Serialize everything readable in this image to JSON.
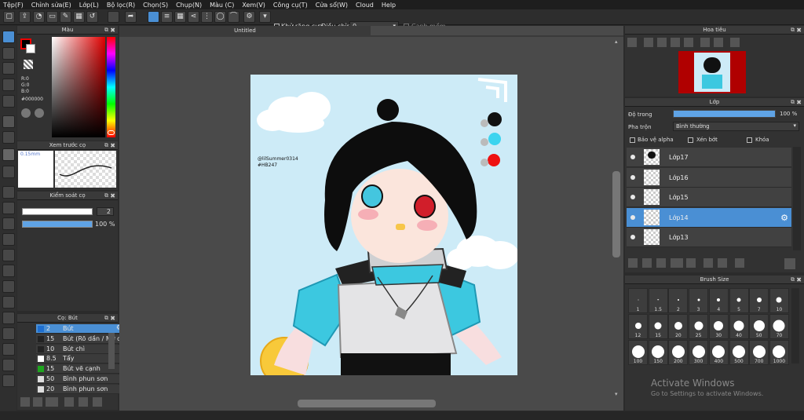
{
  "menu": [
    "Tệp(F)",
    "Chỉnh sửa(E)",
    "Lớp(L)",
    "Bộ lọc(R)",
    "Chọn(S)",
    "Chụp(N)",
    "Màu (C)",
    "Xem(V)",
    "Công cụ(T)",
    "Cửa sổ(W)",
    "Cloud",
    "Help"
  ],
  "toolbar": {
    "antialias_label": "Khử răng cưa",
    "correction_label": "Điều chỉnh",
    "correction_value": "0",
    "snap_label": "Cạnh mềm"
  },
  "color_panel": {
    "title": "Màu",
    "r": "R:0",
    "g": "G:0",
    "b": "B:0",
    "hex": "#000000"
  },
  "brush_preview": {
    "title": "Xem trước cọ",
    "size": "0.15mm"
  },
  "brush_control": {
    "title": "Kiểm soát cọ",
    "size_value": "2",
    "opacity_value": "100 %"
  },
  "brush_list": {
    "title": "Cọ: Bút",
    "items": [
      {
        "size": "2",
        "name": "Bút",
        "color": "#1e6ecf",
        "selected": true
      },
      {
        "size": "15",
        "name": "Bút (Rõ dần / Mờ dần)",
        "color": "#222222"
      },
      {
        "size": "10",
        "name": "Bút chì",
        "color": "#222222"
      },
      {
        "size": "8.5",
        "name": "Tẩy",
        "color": "#ffffff"
      },
      {
        "size": "15",
        "name": "Bút vẽ cạnh",
        "color": "#1ea51e"
      },
      {
        "size": "50",
        "name": "Bình phun sơn",
        "color": "#dddddd"
      },
      {
        "size": "20",
        "name": "Bình phun sơn",
        "color": "#dddddd"
      }
    ]
  },
  "canvas": {
    "title": "Untitled",
    "signature": "@lilSummer0314 #HB247"
  },
  "navigator": {
    "title": "Hoa tiêu"
  },
  "layer_panel": {
    "title": "Lớp",
    "opacity_label": "Độ trong",
    "opacity_value": "100 %",
    "blend_label": "Pha trộn",
    "blend_value": "Bình thường",
    "protect_alpha": "Bảo vệ alpha",
    "clipping": "Xén bớt",
    "lock": "Khóa",
    "layers": [
      {
        "name": "Lớp17",
        "selected": false
      },
      {
        "name": "Lớp16",
        "selected": false
      },
      {
        "name": "Lớp15",
        "selected": false
      },
      {
        "name": "Lớp14",
        "selected": true
      },
      {
        "name": "Lớp13",
        "selected": false
      }
    ]
  },
  "brush_size": {
    "title": "Brush Size",
    "sizes": [
      "1",
      "1.5",
      "2",
      "3",
      "4",
      "5",
      "7",
      "10",
      "12",
      "15",
      "20",
      "25",
      "30",
      "40",
      "50",
      "70",
      "100",
      "150",
      "200",
      "300",
      "400",
      "500",
      "700",
      "1000"
    ]
  },
  "watermark": {
    "title": "Activate Windows",
    "subtitle": "Go to Settings to activate Windows."
  },
  "colors": {
    "accent": "#4a8fd4",
    "bg": "#2b2b2b",
    "panel": "#323232"
  }
}
